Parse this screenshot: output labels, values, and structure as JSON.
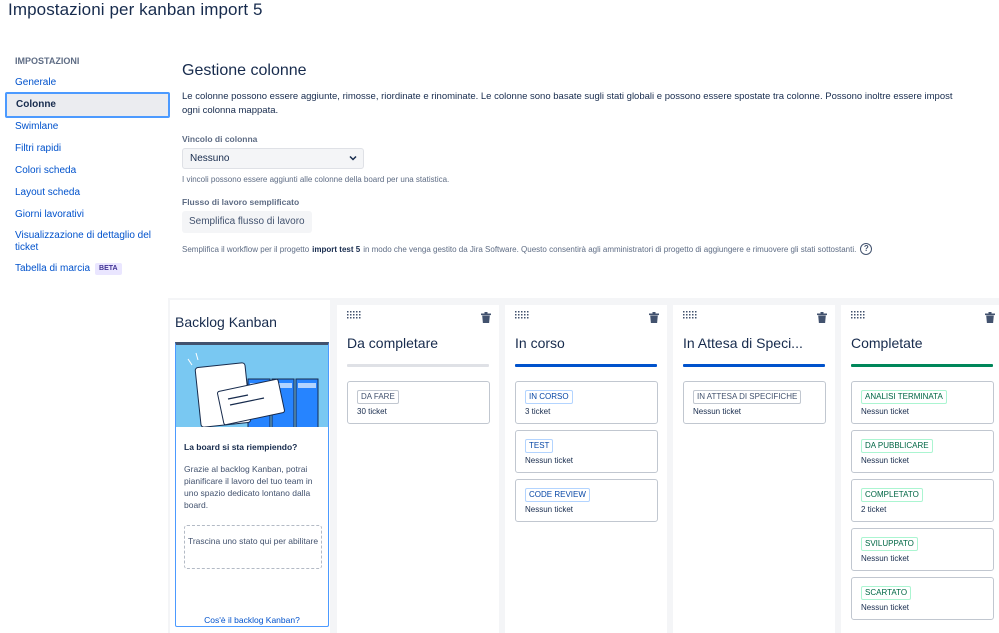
{
  "page": {
    "title": "Impostazioni per kanban import 5"
  },
  "sidebar": {
    "heading": "IMPOSTAZIONI",
    "items": [
      {
        "label": "Generale"
      },
      {
        "label": "Colonne",
        "active": true
      },
      {
        "label": "Swimlane"
      },
      {
        "label": "Filtri rapidi"
      },
      {
        "label": "Colori scheda"
      },
      {
        "label": "Layout scheda"
      },
      {
        "label": "Giorni lavorativi"
      },
      {
        "label": "Visualizzazione di dettaglio del ticket"
      },
      {
        "label": "Tabella di marcia",
        "badge": "BETA"
      }
    ]
  },
  "main": {
    "heading": "Gestione colonne",
    "description_line1": "Le colonne possono essere aggiunte, rimosse, riordinate e rinominate. Le colonne sono basate sugli stati globali e possono essere spostate tra colonne. Possono inoltre essere impost",
    "description_line2": "ogni colonna mappata.",
    "constraint_label": "Vincolo di colonna",
    "constraint_value": "Nessuno",
    "constraint_helper": "I vincoli possono essere aggiunti alle colonne della board per una statistica.",
    "workflow_label": "Flusso di lavoro semplificato",
    "workflow_button": "Semplifica flusso di lavoro",
    "workflow_helper_before": "Semplifica il workflow per il progetto",
    "workflow_helper_project": "import test 5",
    "workflow_helper_after": "in modo che venga gestito da Jira Software. Questo consentirà agli amministratori di progetto di aggiungere e rimuovere gli stati sottostanti.",
    "help_icon_glyph": "?"
  },
  "backlog": {
    "title": "Backlog Kanban",
    "question": "La board si sta riempiendo?",
    "text": "Grazie al backlog Kanban, potrai pianificare il lavoro del tuo team in uno spazio dedicato lontano dalla board.",
    "dropzone": "Trascina uno stato qui per abilitare",
    "link": "Cos'è il backlog Kanban?"
  },
  "columns": [
    {
      "title": "Da completare",
      "bar_color": "#dfe1e6",
      "lozenge_style": "gray",
      "statuses": [
        {
          "name": "DA FARE",
          "count": "30 ticket"
        }
      ]
    },
    {
      "title": "In corso",
      "bar_color": "#0052cc",
      "lozenge_style": "blue",
      "statuses": [
        {
          "name": "IN CORSO",
          "count": "3 ticket"
        },
        {
          "name": "TEST",
          "count": "Nessun ticket"
        },
        {
          "name": "CODE REVIEW",
          "count": "Nessun ticket"
        }
      ]
    },
    {
      "title": "In Attesa di Speci...",
      "bar_color": "#0052cc",
      "lozenge_style": "gray",
      "statuses": [
        {
          "name": "IN ATTESA DI SPECIFICHE",
          "count": "Nessun ticket"
        }
      ]
    },
    {
      "title": "Completate",
      "bar_color": "#00875a",
      "lozenge_style": "green",
      "statuses": [
        {
          "name": "ANALISI TERMINATA",
          "count": "Nessun ticket"
        },
        {
          "name": "DA PUBBLICARE",
          "count": "Nessun ticket"
        },
        {
          "name": "COMPLETATO",
          "count": "2 ticket"
        },
        {
          "name": "SVILUPPATO",
          "count": "Nessun ticket"
        },
        {
          "name": "SCARTATO",
          "count": "Nessun ticket"
        }
      ]
    }
  ],
  "icons": {
    "drag": "drag-handle-icon",
    "delete": "trash-icon",
    "select": "chevron-down-icon",
    "help": "question-circle-icon"
  }
}
